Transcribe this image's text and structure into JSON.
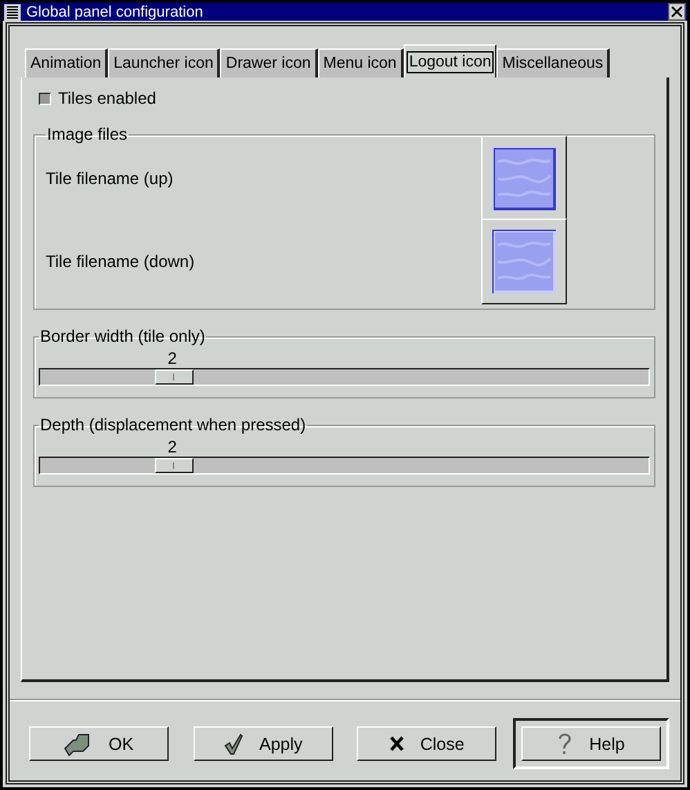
{
  "window": {
    "title": "Global panel configuration"
  },
  "tabs": [
    {
      "label": "Animation",
      "selected": false
    },
    {
      "label": "Launcher icon",
      "selected": false
    },
    {
      "label": "Drawer icon",
      "selected": false
    },
    {
      "label": "Menu icon",
      "selected": false
    },
    {
      "label": "Logout icon",
      "selected": true
    },
    {
      "label": "Miscellaneous",
      "selected": false
    }
  ],
  "tiles_enabled": {
    "label": "Tiles enabled",
    "checked": false
  },
  "image_files": {
    "title": "Image files",
    "rows": [
      {
        "label": "Tile filename (up)",
        "kind": "up"
      },
      {
        "label": "Tile filename (down)",
        "kind": "down"
      }
    ]
  },
  "sliders": [
    {
      "title": "Border width (tile only)",
      "reading": "2"
    },
    {
      "title": "Depth (displacement when pressed)",
      "reading": "2"
    }
  ],
  "buttons": [
    {
      "label": "OK",
      "kind": "ok",
      "default": false
    },
    {
      "label": "Apply",
      "kind": "apply",
      "default": false
    },
    {
      "label": "Close",
      "kind": "close",
      "default": false
    },
    {
      "label": "Help",
      "kind": "help",
      "default": true
    }
  ]
}
